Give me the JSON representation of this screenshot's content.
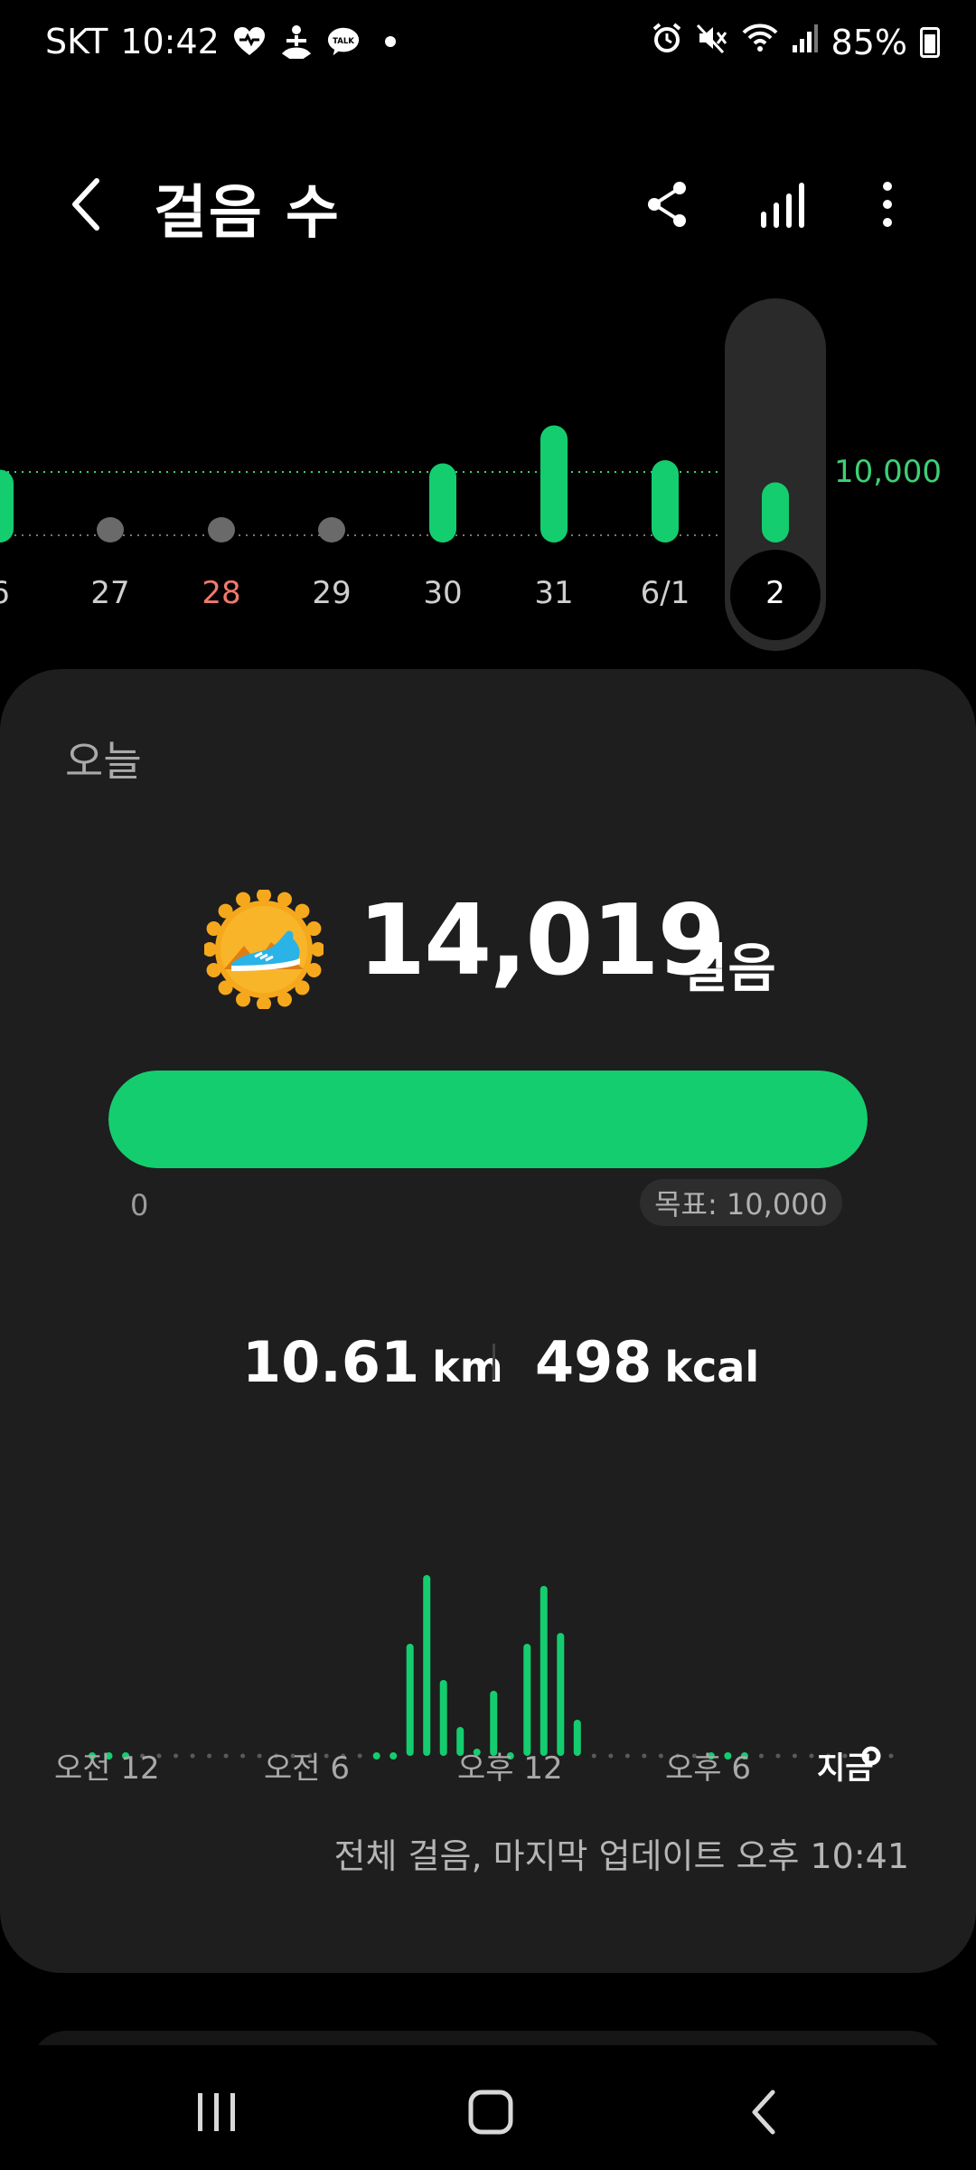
{
  "status_bar": {
    "carrier": "SKT",
    "time": "10:42",
    "notification_icons": [
      "health-heart-icon",
      "yoga-icon",
      "kakaotalk-icon",
      "dot-icon"
    ],
    "talk_badge": "TALK",
    "system_icons": [
      "alarm-icon",
      "mute-icon",
      "wifi-icon",
      "signal-icon"
    ],
    "battery": "85%"
  },
  "app_bar": {
    "title": "걸음 수",
    "actions": [
      "share-icon",
      "bar-chart-icon",
      "more-icon"
    ]
  },
  "weekly_chart": {
    "goal_label": "10,000",
    "days": [
      "6",
      "27",
      "28",
      "29",
      "30",
      "31",
      "6/1",
      "2"
    ],
    "highlighted_day": "28",
    "selected_day": "2",
    "colors": {
      "bar": "#14cd6f",
      "inactive": "#6a6a6a",
      "goal_line": "#3ecf76",
      "sunday": "#f07a6c"
    }
  },
  "chart_data": {
    "type": "bar",
    "title": "",
    "categories": [
      "6",
      "27",
      "28",
      "29",
      "30",
      "31",
      "6/1",
      "2"
    ],
    "values": [
      11500,
      700,
      1300,
      2000,
      12500,
      18500,
      13000,
      9500
    ],
    "goal": 10000,
    "ylim": [
      0,
      20000
    ]
  },
  "today": {
    "label": "오늘",
    "steps": "14,019",
    "unit": "걸음",
    "progress_percent": 100,
    "progress_min": "0",
    "goal_text": "목표: 10,000",
    "distance_value": "10.61",
    "distance_unit": "km",
    "calories_value": "498",
    "calories_unit": "kcal",
    "time_labels": [
      "오전 12",
      "오전 6",
      "오후 12",
      "오후 6",
      "지금"
    ],
    "update_note": "전체 걸음, 마지막 업데이트 오후 10:41",
    "intraday": {
      "type": "bar",
      "slots": 48,
      "values_by_slot": {
        "19": 0.62,
        "20": 1.0,
        "21": 0.42,
        "22": 0.16,
        "23": 0.04,
        "24": 0.36,
        "26": 0.62,
        "27": 0.94,
        "28": 0.68,
        "29": 0.2
      },
      "active_dots": [
        0,
        1,
        2,
        17,
        18,
        22,
        25,
        37,
        38,
        39
      ]
    }
  },
  "nav_bar": {
    "buttons": [
      "recent-apps-icon",
      "home-icon",
      "back-icon"
    ]
  }
}
